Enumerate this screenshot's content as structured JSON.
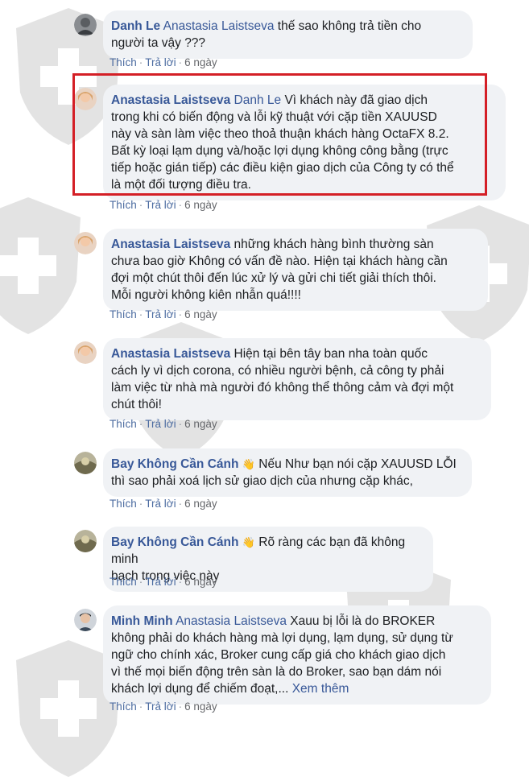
{
  "ui": {
    "like_label": "Thích",
    "reply_label": "Trả lời",
    "separator": "·",
    "see_more": "Xem thêm"
  },
  "comments": [
    {
      "author": "Danh Le",
      "mention": "Anastasia Laistseva",
      "text_lines": [
        "thế sao không trả tiền cho",
        "người ta vậy ???"
      ],
      "time": "6 ngày"
    },
    {
      "author": "Anastasia Laistseva",
      "mention": "Danh Le",
      "text_lines": [
        "Vì khách này đã giao dịch",
        "trong khi có biến động và lỗi kỹ thuật với cặp tiền XAUUSD",
        "này và sàn làm việc theo thoả thuận khách hàng OctaFX 8.2.",
        "Bất kỳ loại lạm dụng và/hoặc lợi dụng không công bằng (trực",
        "tiếp hoặc gián tiếp) các điều kiện giao dịch của Công ty có thể",
        "là một đối tượng điều tra."
      ],
      "time": "6 ngày"
    },
    {
      "author": "Anastasia Laistseva",
      "mention": "",
      "text_lines": [
        "những khách hàng bình thường sàn",
        "chưa bao giờ Không có vấn đề nào. Hiện tại khách hàng cần",
        "đợi một chút thôi đến lúc xử lý và gửi chi tiết giải thích thôi.",
        "Mỗi người không kiên nhẫn quá!!!!"
      ],
      "time": "6 ngày"
    },
    {
      "author": "Anastasia Laistseva",
      "mention": "",
      "text_lines": [
        "Hiện tại bên tây ban nha toàn quốc",
        "cách ly vì dịch corona, có nhiều người bệnh, cả công ty phải",
        "làm việc từ nhà mà người đó không thể thông cảm và đợi một",
        "chút thôi!"
      ],
      "time": "6 ngày"
    },
    {
      "author": "Bay Không Cần Cánh",
      "mention": "",
      "badge": "👋",
      "text_lines": [
        "Nếu Như bạn nói cặp XAUUSD LỖI",
        "thì sao phải xoá lịch sử giao dịch của nhưng cặp khác,"
      ],
      "time": "6 ngày"
    },
    {
      "author": "Bay Không Cần Cánh",
      "mention": "",
      "badge": "👋",
      "text_lines": [
        "Rõ ràng các bạn đã không minh",
        "bạch trong việc này"
      ],
      "time": "6 ngày"
    },
    {
      "author": "Minh Minh",
      "mention": "Anastasia Laistseva",
      "text_lines": [
        "Xauu bị lỗi là do BROKER",
        "không phải do khách hàng mà lợi dụng, lạm dụng, sử dụng từ",
        "ngữ cho chính xác, Broker cung cấp giá cho khách giao dịch",
        "vì thế mọi biến động trên sàn là do Broker, sao bạn dám nói",
        "khách lợi dụng để chiếm đoạt,..."
      ],
      "time": "6 ngày"
    }
  ]
}
